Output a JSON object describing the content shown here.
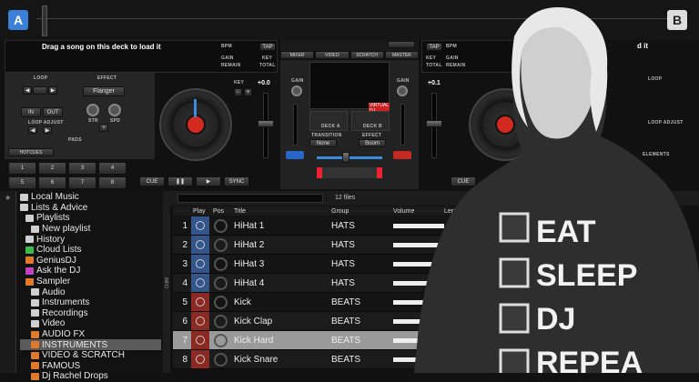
{
  "deckA": {
    "letter": "A",
    "prompt": "Drag a song on this deck to load it",
    "bpm": "BPM",
    "tap": "TAP",
    "gain": "GAIN",
    "key": "KEY",
    "remain": "REMAIN",
    "total": "TOTAL",
    "loop": "LOOP",
    "effect": "EFFECT",
    "effect_name": "Flanger",
    "in": "IN",
    "out": "OUT",
    "loop_adjust": "LOOP ADJUST",
    "str": "STR",
    "spd": "SPD",
    "pads": "PADS",
    "hotcues": "HOTCUES",
    "hotcue_numbers": [
      "1",
      "2",
      "3",
      "4",
      "5",
      "6",
      "7",
      "8"
    ],
    "pitch": "+0.0",
    "cue": "CUE",
    "sync": "SYNC"
  },
  "deckB": {
    "letter": "B",
    "prompt": "d it",
    "tap": "TAP",
    "bpm": "BPM",
    "gain": "GAIN",
    "key": "KEY",
    "remain": "REMAIN",
    "total": "TOTAL",
    "loop": "LOOP",
    "loop_adjust": "LOOP ADJUST",
    "pitch": "+0.1",
    "cue": "CUE",
    "elements": "ELEMENTS"
  },
  "mixer": {
    "tabs": [
      "MIXER",
      "VIDEO",
      "SCRATCH",
      "MASTER"
    ],
    "gain": "GAIN",
    "decka": "DECK A",
    "deckb": "DECK B",
    "fx_none": "None",
    "fx_boom": "Boom",
    "transition": "TRANSITION",
    "effect": "EFFECT",
    "video_label": "VIRTUAL DJ"
  },
  "browser": {
    "file_count": "12 files",
    "search_placeholder": "",
    "columns": {
      "play": "Play",
      "pos": "Pos",
      "title": "Title",
      "group": "Group",
      "volume": "Volume",
      "length": "Leng"
    },
    "side_tab": "INFO"
  },
  "tree": [
    {
      "label": "Local Music",
      "icon": "disk-icon",
      "color": "#cfcfcf",
      "indent": 0
    },
    {
      "label": "Lists & Advice",
      "icon": "list-icon",
      "color": "#cfcfcf",
      "indent": 0
    },
    {
      "label": "Playlists",
      "icon": "folder-icon",
      "color": "#cfcfcf",
      "indent": 1
    },
    {
      "label": "New playlist",
      "icon": "playlist-icon",
      "color": "#cfcfcf",
      "indent": 2
    },
    {
      "label": "History",
      "icon": "history-icon",
      "color": "#cfcfcf",
      "indent": 1
    },
    {
      "label": "Cloud Lists",
      "icon": "cloud-icon",
      "color": "#3dbb4a",
      "indent": 1
    },
    {
      "label": "GeniusDJ",
      "icon": "genius-icon",
      "color": "#e07a2a",
      "indent": 1
    },
    {
      "label": "Ask the DJ",
      "icon": "askdj-icon",
      "color": "#c040c0",
      "indent": 1
    },
    {
      "label": "Sampler",
      "icon": "sampler-icon",
      "color": "#e07a2a",
      "indent": 1
    },
    {
      "label": "Audio",
      "icon": "audio-icon",
      "color": "#cfcfcf",
      "indent": 2
    },
    {
      "label": "Instruments",
      "icon": "instruments-icon",
      "color": "#cfcfcf",
      "indent": 2
    },
    {
      "label": "Recordings",
      "icon": "recordings-icon",
      "color": "#cfcfcf",
      "indent": 2
    },
    {
      "label": "Video",
      "icon": "video-icon",
      "color": "#cfcfcf",
      "indent": 2
    },
    {
      "label": "AUDIO FX",
      "icon": "fx-icon",
      "color": "#e07a2a",
      "indent": 2
    },
    {
      "label": "INSTRUMENTS",
      "icon": "fx-icon",
      "color": "#e07a2a",
      "indent": 2,
      "selected": true
    },
    {
      "label": "VIDEO & SCRATCH",
      "icon": "fx-icon",
      "color": "#e07a2a",
      "indent": 2
    },
    {
      "label": "FAMOUS",
      "icon": "fx-icon",
      "color": "#e07a2a",
      "indent": 2
    },
    {
      "label": "Dj Rachel Drops",
      "icon": "fx-icon",
      "color": "#e07a2a",
      "indent": 2
    }
  ],
  "tracks": [
    {
      "num": "1",
      "title": "HiHat 1",
      "group": "HATS",
      "kind": "hat"
    },
    {
      "num": "2",
      "title": "HiHat 2",
      "group": "HATS",
      "kind": "hat"
    },
    {
      "num": "3",
      "title": "HiHat 3",
      "group": "HATS",
      "kind": "hat"
    },
    {
      "num": "4",
      "title": "HiHat 4",
      "group": "HATS",
      "kind": "hat"
    },
    {
      "num": "5",
      "title": "Kick",
      "group": "BEATS",
      "kind": "beat"
    },
    {
      "num": "6",
      "title": "Kick Clap",
      "group": "BEATS",
      "kind": "beat"
    },
    {
      "num": "7",
      "title": "Kick Hard",
      "group": "BEATS",
      "kind": "beat",
      "selected": true
    },
    {
      "num": "8",
      "title": "Kick Snare",
      "group": "BEATS",
      "kind": "beat"
    }
  ],
  "shirt": {
    "lines": [
      "EAT",
      "SLEEP",
      "DJ",
      "REPEA"
    ]
  },
  "colors": {
    "hat": "#33558a",
    "beat": "#8a2a22",
    "accent": "#3a6fd0",
    "selected_row": "#9a9a9a"
  }
}
